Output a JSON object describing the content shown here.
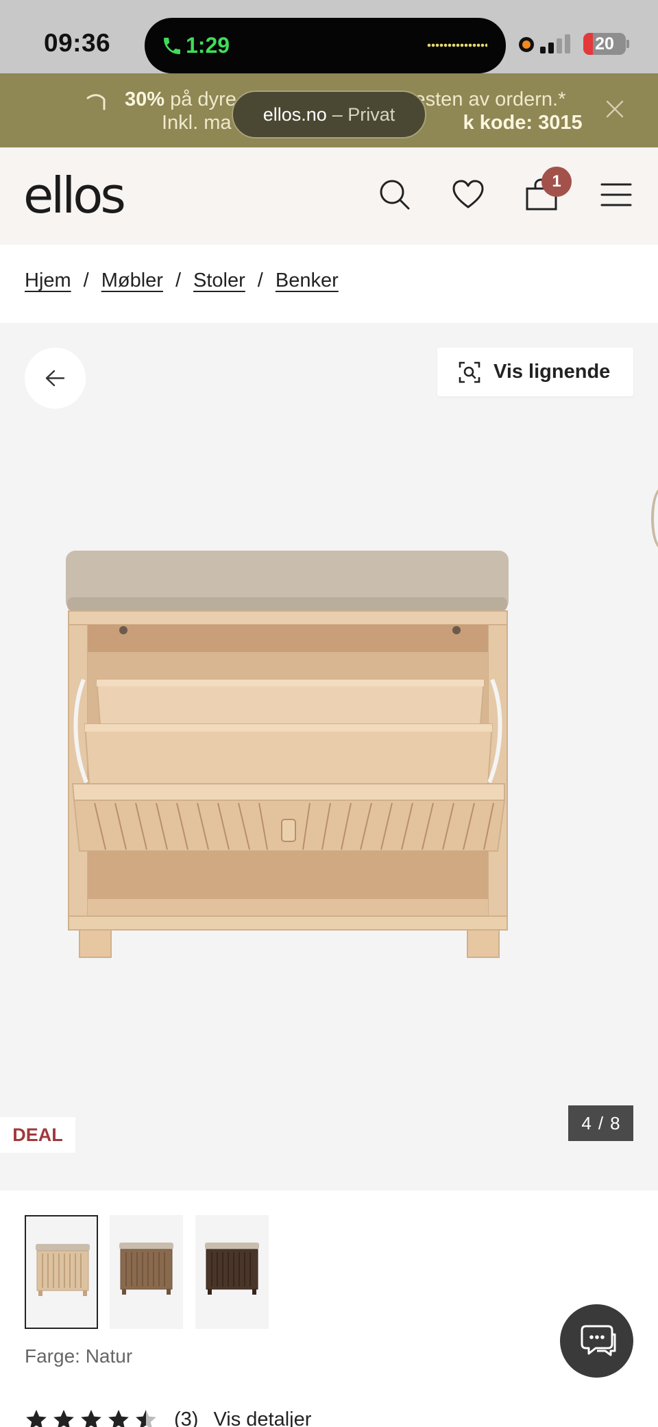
{
  "status_bar": {
    "time": "09:36",
    "call_duration": "1:29",
    "battery": "20"
  },
  "promo": {
    "line1_bold": "30%",
    "line1_text_a": " på dyre",
    "line1_text_b": "resten av ordern.*",
    "line2_text_a": "Inkl. ma",
    "line2_text_b": "k kode: 3015"
  },
  "url_bar": {
    "domain": "ellos.no",
    "mode": "– Privat"
  },
  "header": {
    "logo": "ellos",
    "cart_count": "1"
  },
  "breadcrumb": [
    "Hjem",
    "Møbler",
    "Stoler",
    "Benker"
  ],
  "gallery": {
    "similar_button": "Vis lignende",
    "deal_badge": "DEAL",
    "current_image": "4",
    "separator": "/",
    "total_images": "8"
  },
  "thumbnails": [
    {
      "color": "Natur",
      "hex": "#d8bfa2"
    },
    {
      "color": "Brun",
      "hex": "#8a6a4e"
    },
    {
      "color": "Mørkebrun",
      "hex": "#4a3628"
    }
  ],
  "color_label": "Farge: Natur",
  "rating": {
    "value": 4.5,
    "max": 5,
    "count": "(3)",
    "details_link": "Vis detaljer"
  },
  "colors": {
    "promo_bg": "#8f8754",
    "header_bg": "#f7f4f2",
    "cart_badge": "#a2524b",
    "deal_text": "#a2383c",
    "gallery_bg": "#f4f4f5"
  }
}
